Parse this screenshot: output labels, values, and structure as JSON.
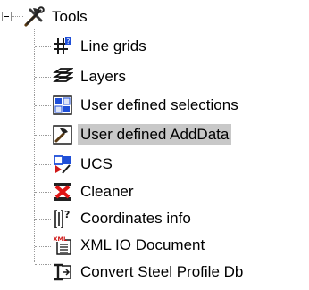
{
  "tree": {
    "root": {
      "label": "Tools",
      "icon": "tools-icon",
      "expanded": true
    },
    "items": [
      {
        "label": "Line grids",
        "icon": "line-grids-icon"
      },
      {
        "label": "Layers",
        "icon": "layers-icon"
      },
      {
        "label": "User defined selections",
        "icon": "user-selections-icon"
      },
      {
        "label": "User defined AddData",
        "icon": "add-data-icon",
        "selected": true
      },
      {
        "label": "UCS",
        "icon": "ucs-icon"
      },
      {
        "label": "Cleaner",
        "icon": "cleaner-icon"
      },
      {
        "label": "Coordinates info",
        "icon": "coordinates-info-icon"
      },
      {
        "label": "XML IO Document",
        "icon": "xml-document-icon"
      },
      {
        "label": "Convert Steel Profile Db",
        "icon": "convert-profile-icon"
      }
    ]
  },
  "colors": {
    "selection": "#c8c8c8",
    "connector": "#9a9a9a"
  }
}
